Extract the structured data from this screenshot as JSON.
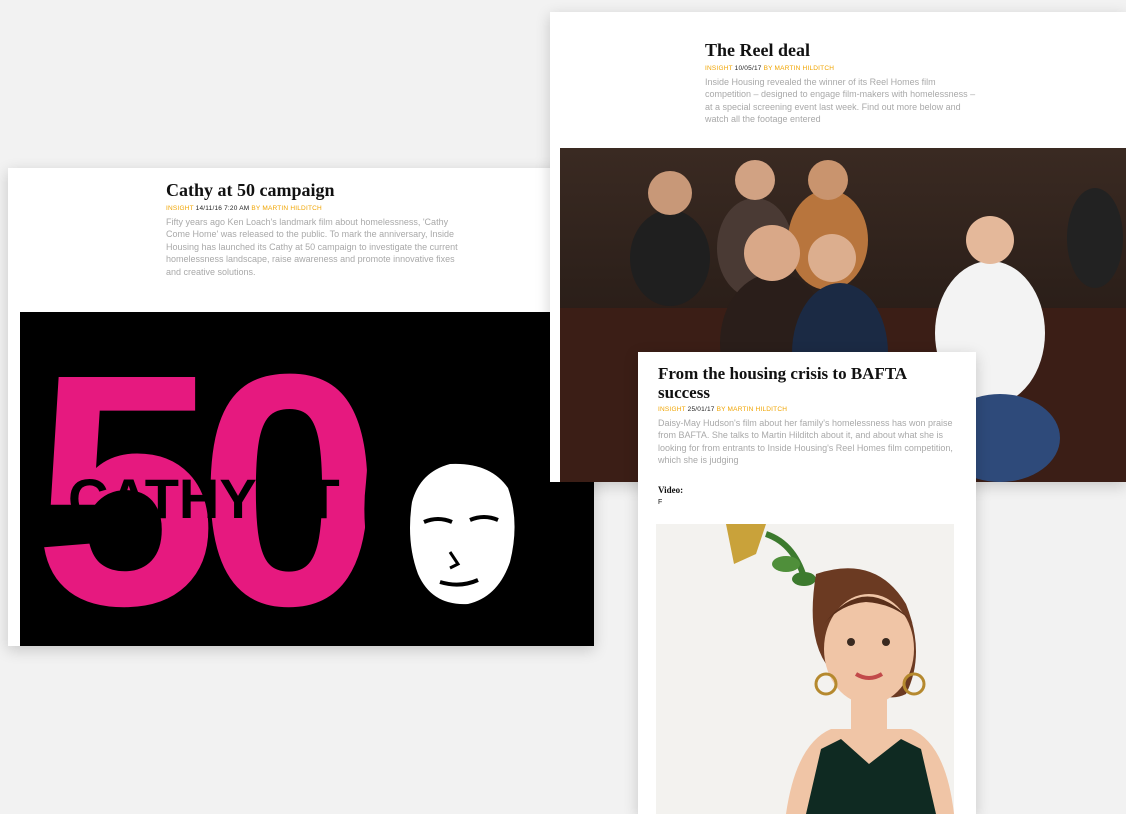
{
  "cards": [
    {
      "title": "Cathy at 50 campaign",
      "kind": "INSIGHT",
      "date": "14/11/16 7:20 AM",
      "byline": "BY MARTIN HILDITCH",
      "body": "Fifty years ago Ken Loach's landmark film about homelessness, 'Cathy Come Home' was released to the public. To mark the anniversary, Inside Housing has launched its Cathy at 50 campaign to investigate the current homelessness landscape, raise awareness and promote innovative fixes and creative solutions.",
      "poster_text": "CATHY AT",
      "poster_number": "50"
    },
    {
      "title": "The Reel deal",
      "kind": "INSIGHT",
      "date": "10/05/17",
      "byline": "BY MARTIN HILDITCH",
      "body": "Inside Housing revealed the winner of its Reel Homes film competition – designed to engage film-makers with homelessness – at a special screening event last week. Find out more below and watch all the footage entered"
    },
    {
      "title": "From the housing crisis to BAFTA success",
      "kind": "INSIGHT",
      "date": "25/01/17",
      "byline": "BY MARTIN HILDITCH",
      "body": "Daisy-May Hudson's film about her family's homelessness has won praise from BAFTA. She talks to Martin Hilditch about it, and about what she is looking for from entrants to Inside Housing's Reel Homes film competition, which she is judging",
      "video_label": "Video:",
      "video_value": "F"
    }
  ],
  "colors": {
    "accent": "#f0a400",
    "poster_pink": "#e6197f",
    "poster_black": "#000000"
  }
}
